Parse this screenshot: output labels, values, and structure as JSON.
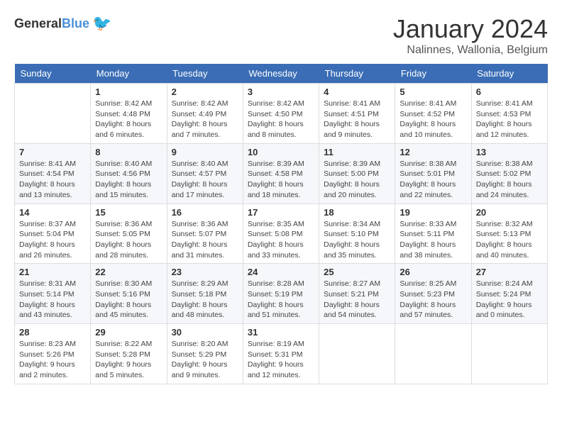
{
  "header": {
    "logo_general": "General",
    "logo_blue": "Blue",
    "month_title": "January 2024",
    "location": "Nalinnes, Wallonia, Belgium"
  },
  "columns": [
    "Sunday",
    "Monday",
    "Tuesday",
    "Wednesday",
    "Thursday",
    "Friday",
    "Saturday"
  ],
  "weeks": [
    [
      {
        "day": "",
        "info": ""
      },
      {
        "day": "1",
        "info": "Sunrise: 8:42 AM\nSunset: 4:48 PM\nDaylight: 8 hours\nand 6 minutes."
      },
      {
        "day": "2",
        "info": "Sunrise: 8:42 AM\nSunset: 4:49 PM\nDaylight: 8 hours\nand 7 minutes."
      },
      {
        "day": "3",
        "info": "Sunrise: 8:42 AM\nSunset: 4:50 PM\nDaylight: 8 hours\nand 8 minutes."
      },
      {
        "day": "4",
        "info": "Sunrise: 8:41 AM\nSunset: 4:51 PM\nDaylight: 8 hours\nand 9 minutes."
      },
      {
        "day": "5",
        "info": "Sunrise: 8:41 AM\nSunset: 4:52 PM\nDaylight: 8 hours\nand 10 minutes."
      },
      {
        "day": "6",
        "info": "Sunrise: 8:41 AM\nSunset: 4:53 PM\nDaylight: 8 hours\nand 12 minutes."
      }
    ],
    [
      {
        "day": "7",
        "info": "Sunrise: 8:41 AM\nSunset: 4:54 PM\nDaylight: 8 hours\nand 13 minutes."
      },
      {
        "day": "8",
        "info": "Sunrise: 8:40 AM\nSunset: 4:56 PM\nDaylight: 8 hours\nand 15 minutes."
      },
      {
        "day": "9",
        "info": "Sunrise: 8:40 AM\nSunset: 4:57 PM\nDaylight: 8 hours\nand 17 minutes."
      },
      {
        "day": "10",
        "info": "Sunrise: 8:39 AM\nSunset: 4:58 PM\nDaylight: 8 hours\nand 18 minutes."
      },
      {
        "day": "11",
        "info": "Sunrise: 8:39 AM\nSunset: 5:00 PM\nDaylight: 8 hours\nand 20 minutes."
      },
      {
        "day": "12",
        "info": "Sunrise: 8:38 AM\nSunset: 5:01 PM\nDaylight: 8 hours\nand 22 minutes."
      },
      {
        "day": "13",
        "info": "Sunrise: 8:38 AM\nSunset: 5:02 PM\nDaylight: 8 hours\nand 24 minutes."
      }
    ],
    [
      {
        "day": "14",
        "info": "Sunrise: 8:37 AM\nSunset: 5:04 PM\nDaylight: 8 hours\nand 26 minutes."
      },
      {
        "day": "15",
        "info": "Sunrise: 8:36 AM\nSunset: 5:05 PM\nDaylight: 8 hours\nand 28 minutes."
      },
      {
        "day": "16",
        "info": "Sunrise: 8:36 AM\nSunset: 5:07 PM\nDaylight: 8 hours\nand 31 minutes."
      },
      {
        "day": "17",
        "info": "Sunrise: 8:35 AM\nSunset: 5:08 PM\nDaylight: 8 hours\nand 33 minutes."
      },
      {
        "day": "18",
        "info": "Sunrise: 8:34 AM\nSunset: 5:10 PM\nDaylight: 8 hours\nand 35 minutes."
      },
      {
        "day": "19",
        "info": "Sunrise: 8:33 AM\nSunset: 5:11 PM\nDaylight: 8 hours\nand 38 minutes."
      },
      {
        "day": "20",
        "info": "Sunrise: 8:32 AM\nSunset: 5:13 PM\nDaylight: 8 hours\nand 40 minutes."
      }
    ],
    [
      {
        "day": "21",
        "info": "Sunrise: 8:31 AM\nSunset: 5:14 PM\nDaylight: 8 hours\nand 43 minutes."
      },
      {
        "day": "22",
        "info": "Sunrise: 8:30 AM\nSunset: 5:16 PM\nDaylight: 8 hours\nand 45 minutes."
      },
      {
        "day": "23",
        "info": "Sunrise: 8:29 AM\nSunset: 5:18 PM\nDaylight: 8 hours\nand 48 minutes."
      },
      {
        "day": "24",
        "info": "Sunrise: 8:28 AM\nSunset: 5:19 PM\nDaylight: 8 hours\nand 51 minutes."
      },
      {
        "day": "25",
        "info": "Sunrise: 8:27 AM\nSunset: 5:21 PM\nDaylight: 8 hours\nand 54 minutes."
      },
      {
        "day": "26",
        "info": "Sunrise: 8:25 AM\nSunset: 5:23 PM\nDaylight: 8 hours\nand 57 minutes."
      },
      {
        "day": "27",
        "info": "Sunrise: 8:24 AM\nSunset: 5:24 PM\nDaylight: 9 hours\nand 0 minutes."
      }
    ],
    [
      {
        "day": "28",
        "info": "Sunrise: 8:23 AM\nSunset: 5:26 PM\nDaylight: 9 hours\nand 2 minutes."
      },
      {
        "day": "29",
        "info": "Sunrise: 8:22 AM\nSunset: 5:28 PM\nDaylight: 9 hours\nand 5 minutes."
      },
      {
        "day": "30",
        "info": "Sunrise: 8:20 AM\nSunset: 5:29 PM\nDaylight: 9 hours\nand 9 minutes."
      },
      {
        "day": "31",
        "info": "Sunrise: 8:19 AM\nSunset: 5:31 PM\nDaylight: 9 hours\nand 12 minutes."
      },
      {
        "day": "",
        "info": ""
      },
      {
        "day": "",
        "info": ""
      },
      {
        "day": "",
        "info": ""
      }
    ]
  ]
}
